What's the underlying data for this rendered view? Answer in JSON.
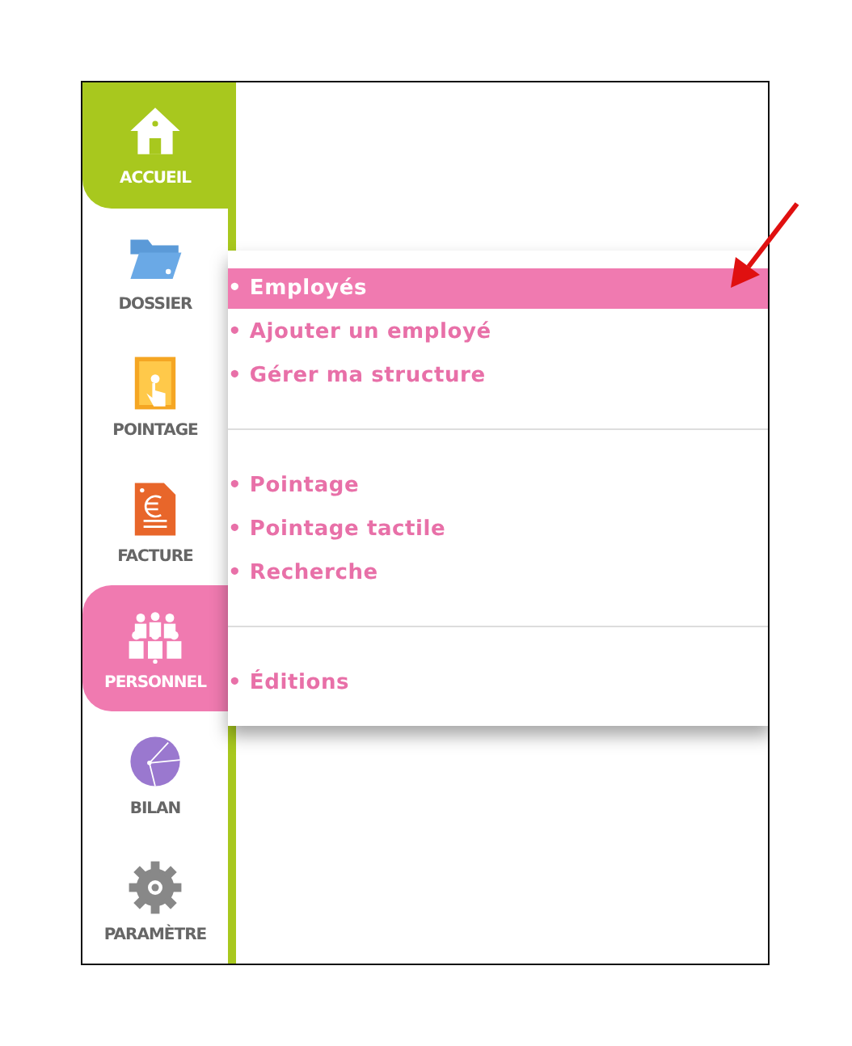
{
  "sidebar": {
    "items": [
      {
        "label": "ACCUEIL",
        "selected": true,
        "color": "#a8c81e"
      },
      {
        "label": "DOSSIER",
        "selected": false
      },
      {
        "label": "POINTAGE",
        "selected": false
      },
      {
        "label": "FACTURE",
        "selected": false
      },
      {
        "label": "PERSONNEL",
        "selected": true,
        "color": "#f07ab0"
      },
      {
        "label": "BILAN",
        "selected": false
      },
      {
        "label": "PARAMÈTRE",
        "selected": false
      }
    ]
  },
  "menu": {
    "groups": [
      {
        "items": [
          {
            "label": "• Employés",
            "selected": true
          },
          {
            "label": "• Ajouter un employé",
            "selected": false
          },
          {
            "label": "• Gérer ma structure",
            "selected": false
          }
        ]
      },
      {
        "items": [
          {
            "label": "• Pointage",
            "selected": false
          },
          {
            "label": "• Pointage tactile",
            "selected": false
          },
          {
            "label": "• Recherche",
            "selected": false
          }
        ]
      },
      {
        "items": [
          {
            "label": "• Éditions",
            "selected": false
          }
        ]
      }
    ]
  }
}
